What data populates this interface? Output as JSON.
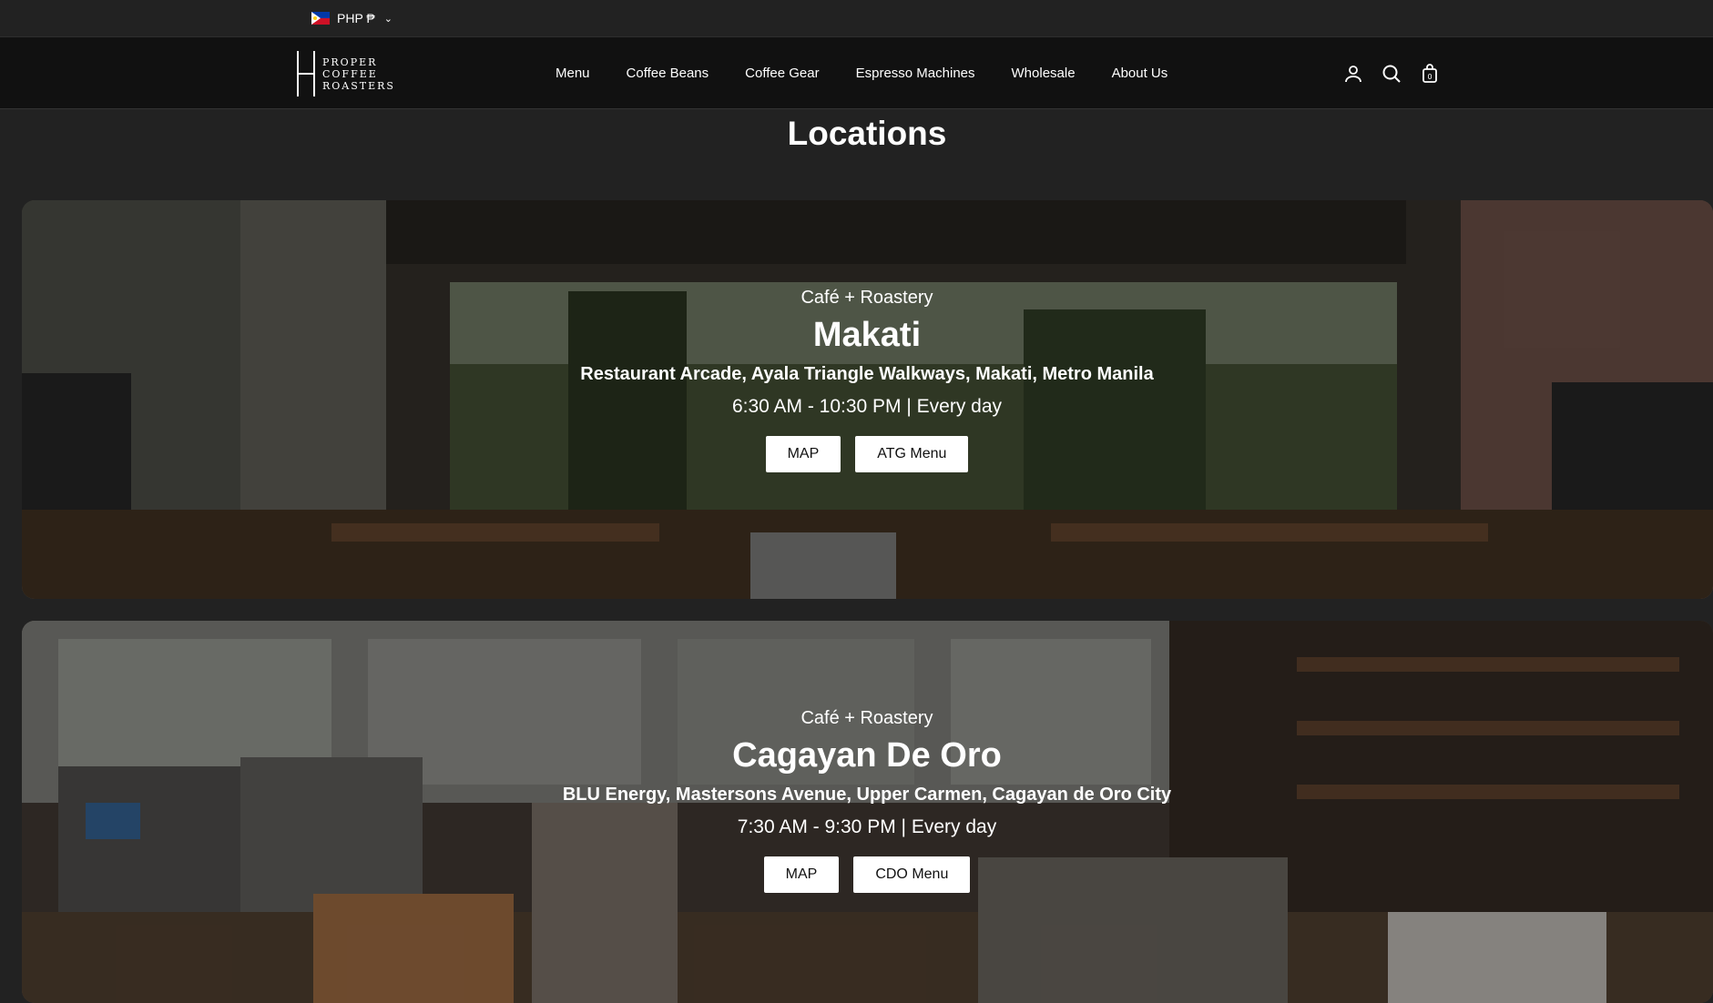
{
  "topbar": {
    "currency_label": "PHP ₱",
    "flag_icon": "philippines-flag-icon",
    "dropdown_icon": "chevron-down-icon"
  },
  "header": {
    "logo_lines": [
      "PROPER",
      "COFFEE",
      "ROASTERS"
    ],
    "nav": [
      "Menu",
      "Coffee Beans",
      "Coffee Gear",
      "Espresso Machines",
      "Wholesale",
      "About Us"
    ],
    "icons": [
      "account-icon",
      "search-icon",
      "cart-icon"
    ]
  },
  "page": {
    "title": "Locations"
  },
  "locations": [
    {
      "type": "Café + Roastery",
      "name": "Makati",
      "address": "Restaurant Arcade, Ayala Triangle Walkways, Makati, Metro Manila",
      "hours": "6:30 AM - 10:30 PM | Every day",
      "map_label": "MAP",
      "menu_label": "ATG Menu"
    },
    {
      "type": "Café + Roastery",
      "name": "Cagayan De Oro",
      "address": "BLU Energy, Mastersons Avenue, Upper Carmen, Cagayan de Oro City",
      "hours": "7:30 AM - 9:30 PM | Every day",
      "map_label": "MAP",
      "menu_label": "CDO Menu"
    }
  ],
  "colors": {
    "page_bg": "#222222",
    "header_bg": "#111111",
    "button_bg": "#ffffff",
    "button_text": "#111111"
  }
}
